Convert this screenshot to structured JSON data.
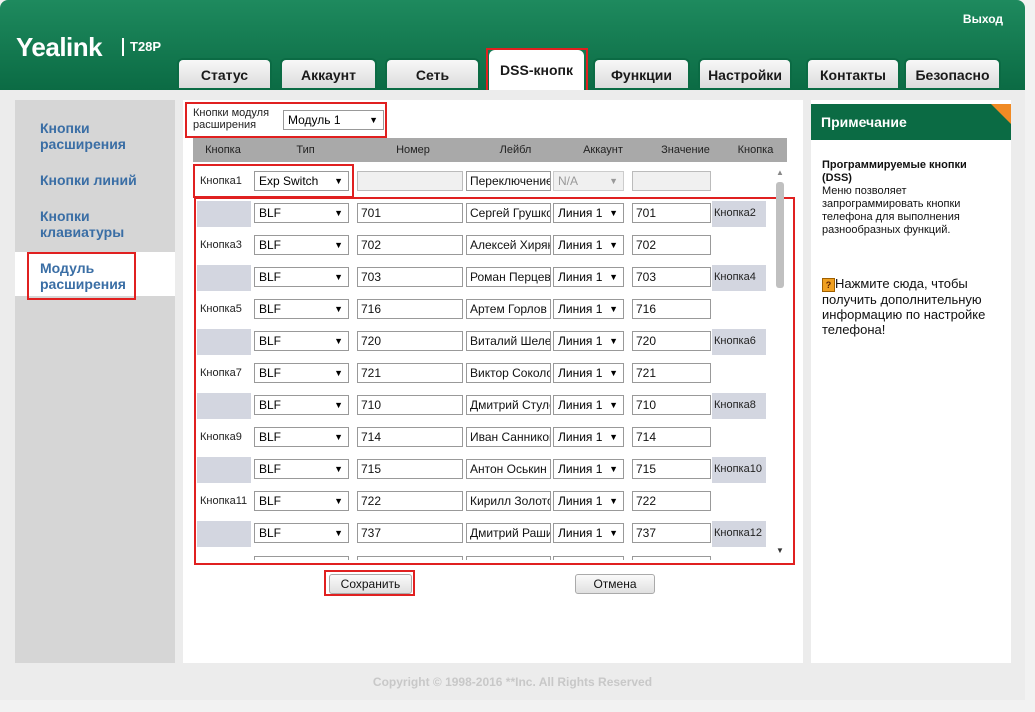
{
  "header": {
    "logo": "Yealink",
    "model": "T28P",
    "logout": "Выход",
    "tabs": [
      "Статус",
      "Аккаунт",
      "Сеть",
      "DSS-кнопк",
      "Функции",
      "Настройки",
      "Контакты",
      "Безопасно"
    ]
  },
  "sidebar": {
    "items": [
      {
        "label": "Кнопки расширения"
      },
      {
        "label": "Кнопки линий"
      },
      {
        "label": "Кнопки клавиатуры"
      },
      {
        "label": "Модуль расширения"
      }
    ]
  },
  "module": {
    "label_line1": "Кнопки модуля",
    "label_line2": "расширения",
    "value": "Модуль 1"
  },
  "table": {
    "headers": [
      "Кнопка",
      "Тип",
      "Номер",
      "Лейбл",
      "Аккаунт",
      "Значение",
      "Кнопка"
    ],
    "first_row": {
      "key": "Кнопка1",
      "type": "Exp Switch",
      "number": "",
      "label": "Переключение",
      "account": "N/A",
      "value": ""
    },
    "rows": [
      {
        "left_key": "",
        "right_key": "Кнопка2",
        "type": "BLF",
        "number": "701",
        "label": "Сергей Грушко",
        "account": "Линия 1",
        "value": "701"
      },
      {
        "left_key": "Кнопка3",
        "right_key": "",
        "type": "BLF",
        "number": "702",
        "label": "Алексей Хиряков",
        "account": "Линия 1",
        "value": "702"
      },
      {
        "left_key": "",
        "right_key": "Кнопка4",
        "type": "BLF",
        "number": "703",
        "label": "Роман Перцев",
        "account": "Линия 1",
        "value": "703"
      },
      {
        "left_key": "Кнопка5",
        "right_key": "",
        "type": "BLF",
        "number": "716",
        "label": "Артем Горлов",
        "account": "Линия 1",
        "value": "716"
      },
      {
        "left_key": "",
        "right_key": "Кнопка6",
        "type": "BLF",
        "number": "720",
        "label": "Виталий Шелест",
        "account": "Линия 1",
        "value": "720"
      },
      {
        "left_key": "Кнопка7",
        "right_key": "",
        "type": "BLF",
        "number": "721",
        "label": "Виктор Соколов",
        "account": "Линия 1",
        "value": "721"
      },
      {
        "left_key": "",
        "right_key": "Кнопка8",
        "type": "BLF",
        "number": "710",
        "label": "Дмитрий Стулов",
        "account": "Линия 1",
        "value": "710"
      },
      {
        "left_key": "Кнопка9",
        "right_key": "",
        "type": "BLF",
        "number": "714",
        "label": "Иван Санников",
        "account": "Линия 1",
        "value": "714"
      },
      {
        "left_key": "",
        "right_key": "Кнопка10",
        "type": "BLF",
        "number": "715",
        "label": "Антон Оськин",
        "account": "Линия 1",
        "value": "715"
      },
      {
        "left_key": "Кнопка11",
        "right_key": "",
        "type": "BLF",
        "number": "722",
        "label": "Кирилл Золотов",
        "account": "Линия 1",
        "value": "722"
      },
      {
        "left_key": "",
        "right_key": "Кнопка12",
        "type": "BLF",
        "number": "737",
        "label": "Дмитрий Рашидов",
        "account": "Линия 1",
        "value": "737"
      }
    ]
  },
  "buttons": {
    "save": "Сохранить",
    "cancel": "Отмена"
  },
  "note": {
    "title": "Примечание",
    "subtitle_line1": "Программируемые кнопки",
    "subtitle_line2": "(DSS)",
    "text": "Меню позволяет запрограммировать кнопки телефона для выполнения разнообразных функций.",
    "help": "Нажмите сюда, чтобы получить дополнительную информацию по настройке телефона!"
  },
  "footer": {
    "copyright": "Copyright © 1998-2016 **Inc. All Rights Reserved"
  },
  "colors": {
    "brand_green": "#0b6b44",
    "highlight_red": "#e02020",
    "sidebar_link": "#3a6ea5",
    "note_corner": "#f08a24"
  }
}
